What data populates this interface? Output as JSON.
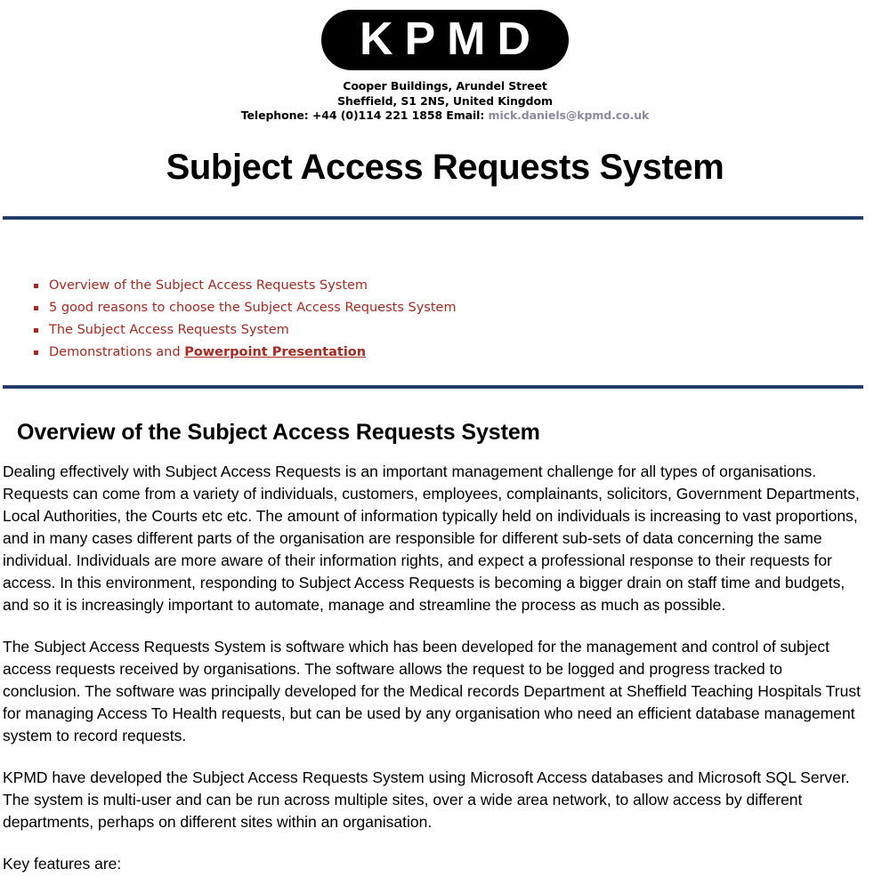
{
  "header": {
    "logo_text": "KPMD",
    "address_line1": "Cooper Buildings, Arundel Street",
    "address_line2": "Sheffield, S1 2NS, United Kingdom",
    "telephone_label": "Telephone: +44 (0)114 221 1858 Email:",
    "email": "mick.daniels@kpmd.co.uk"
  },
  "document": {
    "title": "Subject Access Requests System"
  },
  "toc": {
    "items": [
      {
        "text": "Overview of the Subject Access Requests System",
        "link_text": ""
      },
      {
        "text": "5 good reasons to choose the Subject Access Requests System",
        "link_text": ""
      },
      {
        "text": "The Subject Access Requests System",
        "link_text": ""
      },
      {
        "text": "Demonstrations and ",
        "link_text": "Powerpoint Presentation"
      }
    ]
  },
  "overview": {
    "heading": "Overview of the Subject Access Requests System",
    "paragraphs": [
      "Dealing effectively with Subject Access Requests is an important management challenge for all types of organisations. Requests can come from a variety of individuals, customers, employees, complainants, solicitors, Government Departments, Local Authorities, the Courts etc etc. The amount of information typically held on individuals is increasing to vast proportions, and in many cases different parts of the organisation are responsible for different sub-sets of data concerning the same individual. Individuals are more aware of their information rights, and expect a professional response to their requests for access. In this environment, responding to Subject Access Requests is becoming a bigger drain on staff time and budgets, and so it is increasingly important to automate, manage and streamline the process as much as possible.",
      "The Subject Access Requests System is software which has been developed for the management and control of subject access requests received by organisations. The software allows the request to be logged and progress tracked to conclusion. The software was principally developed for the Medical records Department at Sheffield Teaching Hospitals Trust for managing Access To Health requests, but can be used by any organisation who need an efficient database management system to record requests.",
      "KPMD have developed the Subject Access Requests System using Microsoft Access databases and Microsoft SQL Server. The system is multi-user and can be run across multiple sites, over a wide area network, to allow access by different departments, perhaps on different sites within an organisation.",
      "Key features are:"
    ]
  },
  "colors": {
    "rule": "#1f3864",
    "toc_text": "#a52a21",
    "email_link": "#8a8aa0",
    "logo_background": "#000000",
    "logo_text": "#ffffff"
  }
}
